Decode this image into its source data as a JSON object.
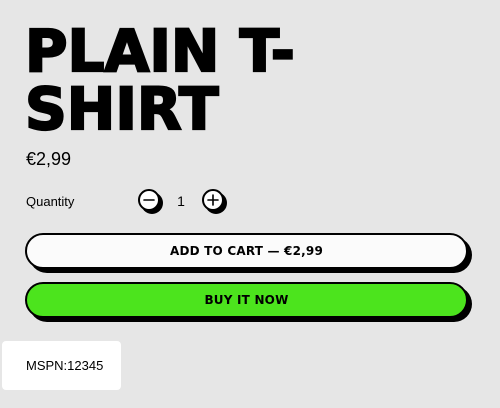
{
  "product": {
    "title": "PLAIN T-SHIRT",
    "price": "€2,99"
  },
  "quantity": {
    "label": "Quantity",
    "value": "1",
    "decrement_icon": "minus-icon",
    "increment_icon": "plus-icon"
  },
  "actions": {
    "add_to_cart_label": "ADD TO CART — €2,99",
    "buy_now_label": "BUY IT NOW"
  },
  "sku": {
    "text": "MSPN:12345"
  },
  "colors": {
    "background": "#e6e6e6",
    "buy_button": "#4ce41d",
    "outline": "#000000"
  }
}
